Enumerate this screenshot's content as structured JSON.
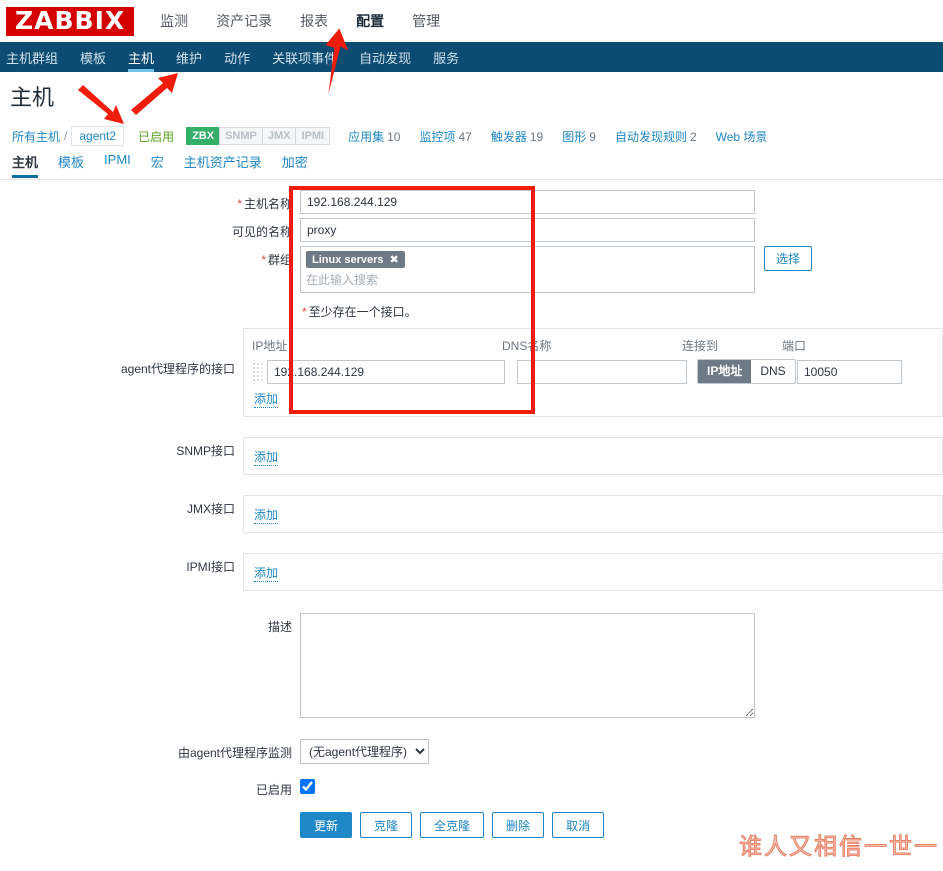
{
  "brand": {
    "logo_text": "ZABBIX"
  },
  "main_menu": [
    {
      "label": "监测",
      "active": false
    },
    {
      "label": "资产记录",
      "active": false
    },
    {
      "label": "报表",
      "active": false
    },
    {
      "label": "配置",
      "active": true
    },
    {
      "label": "管理",
      "active": false
    }
  ],
  "sub_menu": [
    {
      "label": "主机群组",
      "active": false
    },
    {
      "label": "模板",
      "active": false
    },
    {
      "label": "主机",
      "active": true
    },
    {
      "label": "维护",
      "active": false
    },
    {
      "label": "动作",
      "active": false
    },
    {
      "label": "关联项事件",
      "active": false
    },
    {
      "label": "自动发现",
      "active": false
    },
    {
      "label": "服务",
      "active": false
    }
  ],
  "page": {
    "title": "主机"
  },
  "breadcrumb": {
    "all_hosts": "所有主机",
    "separator": "/",
    "current": "agent2",
    "status": "已启用"
  },
  "type_badges": [
    {
      "label": "ZBX",
      "on": true
    },
    {
      "label": "SNMP",
      "on": false
    },
    {
      "label": "JMX",
      "on": false
    },
    {
      "label": "IPMI",
      "on": false
    }
  ],
  "counters": [
    {
      "label": "应用集",
      "count": "10"
    },
    {
      "label": "监控项",
      "count": "47"
    },
    {
      "label": "触发器",
      "count": "19"
    },
    {
      "label": "图形",
      "count": "9"
    },
    {
      "label": "自动发现规则",
      "count": "2"
    },
    {
      "label": "Web 场景",
      "count": ""
    }
  ],
  "tabs": [
    {
      "label": "主机",
      "active": true
    },
    {
      "label": "模板",
      "active": false
    },
    {
      "label": "IPMI",
      "active": false
    },
    {
      "label": "宏",
      "active": false
    },
    {
      "label": "主机资产记录",
      "active": false
    },
    {
      "label": "加密",
      "active": false
    }
  ],
  "form": {
    "host_name": {
      "label": "主机名称",
      "required": true,
      "value": "192.168.244.129"
    },
    "visible_name": {
      "label": "可见的名称",
      "required": false,
      "value": "proxy"
    },
    "groups": {
      "label": "群组",
      "required": true,
      "chips": [
        "Linux servers"
      ],
      "remove_icon": "✖",
      "placeholder": "在此输入搜索",
      "select_button": "选择"
    },
    "interface_hint": "至少存在一个接口。",
    "agent_interface": {
      "label": "agent代理程序的接口",
      "columns": {
        "ip": "IP地址",
        "dns": "DNS名称",
        "connect_to": "连接到",
        "port": "端口"
      },
      "rows": [
        {
          "ip": "192.168.244.129",
          "dns": "",
          "connect_to_options": [
            "IP地址",
            "DNS"
          ],
          "connect_to_selected": "IP地址",
          "port": "10050"
        }
      ],
      "add_label": "添加"
    },
    "snmp_interface": {
      "label": "SNMP接口",
      "add_label": "添加"
    },
    "jmx_interface": {
      "label": "JMX接口",
      "add_label": "添加"
    },
    "ipmi_interface": {
      "label": "IPMI接口",
      "add_label": "添加"
    },
    "description": {
      "label": "描述",
      "value": ""
    },
    "monitored_by_proxy": {
      "label": "由agent代理程序监测",
      "selected": "(无agent代理程序)",
      "options": [
        "(无agent代理程序)"
      ]
    },
    "enabled": {
      "label": "已启用",
      "checked": true
    }
  },
  "buttons": [
    {
      "label": "更新",
      "primary": true
    },
    {
      "label": "克隆",
      "primary": false
    },
    {
      "label": "全克隆",
      "primary": false
    },
    {
      "label": "删除",
      "primary": false
    },
    {
      "label": "取消",
      "primary": false
    }
  ],
  "annotations": {
    "highlight_color": "#f01c0c",
    "arrow_color": "#f01c0c",
    "watermark": "谁人又相信一世一"
  }
}
